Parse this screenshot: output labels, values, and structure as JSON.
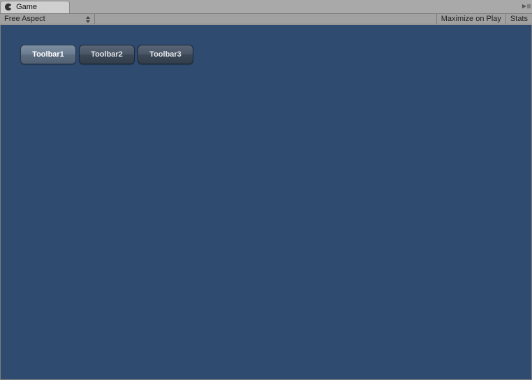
{
  "tab": {
    "label": "Game"
  },
  "controlBar": {
    "aspect": "Free Aspect",
    "maximize": "Maximize on Play",
    "stats": "Stats"
  },
  "toolbar": {
    "items": [
      {
        "label": "Toolbar1",
        "selected": true
      },
      {
        "label": "Toolbar2",
        "selected": false
      },
      {
        "label": "Toolbar3",
        "selected": false
      }
    ]
  }
}
